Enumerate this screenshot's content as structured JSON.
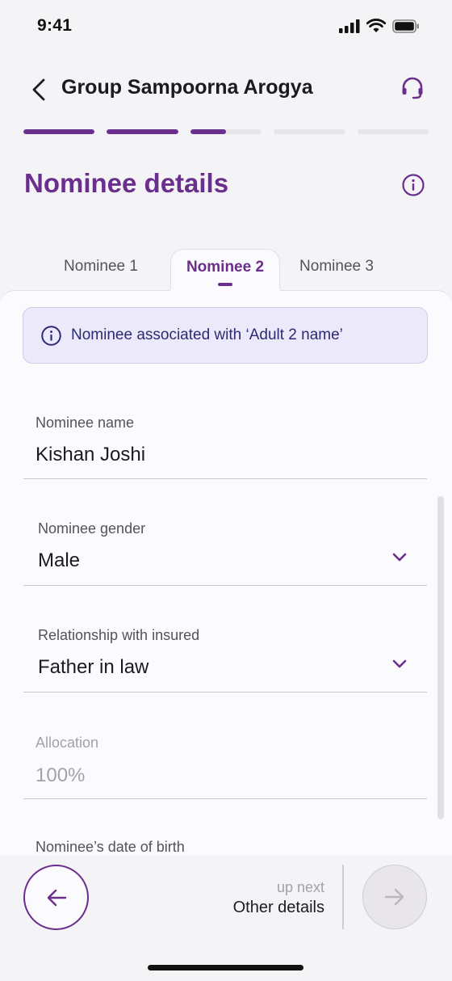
{
  "status_bar": {
    "time": "9:41"
  },
  "header": {
    "title": "Group Sampoorna Arogya"
  },
  "progress": [
    1,
    1,
    0.5,
    0,
    0
  ],
  "section": {
    "title": "Nominee details"
  },
  "tabs": [
    {
      "label": "Nominee 1"
    },
    {
      "label": "Nominee 2"
    },
    {
      "label": "Nominee 3"
    }
  ],
  "banner": {
    "text": "Nominee associated with ‘Adult 2 name’"
  },
  "fields": {
    "name": {
      "label": "Nominee name",
      "value": "Kishan Joshi"
    },
    "gender": {
      "label": "Nominee gender",
      "value": "Male"
    },
    "relationship": {
      "label": "Relationship with insured",
      "value": "Father in law"
    },
    "allocation": {
      "label": "Allocation",
      "value": "100%"
    },
    "dob": {
      "label": "Nominee’s date of birth"
    }
  },
  "footer": {
    "up_next_label": "up next",
    "up_next_value": "Other details"
  },
  "colors": {
    "accent": "#6a2e8c",
    "banner_bg": "#eceafa",
    "banner_text": "#2c2a75"
  }
}
